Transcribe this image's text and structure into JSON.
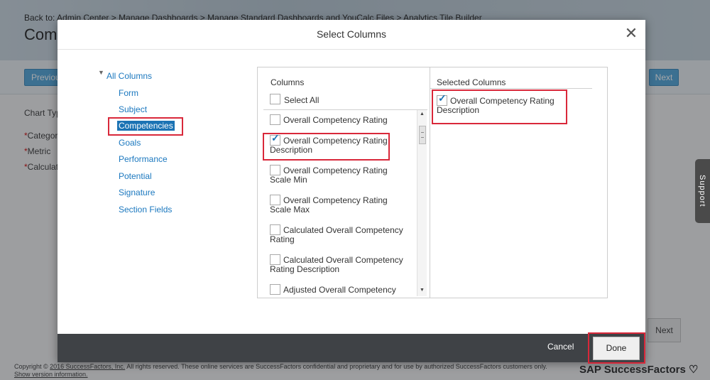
{
  "background": {
    "breadcrumb": "Back to: Admin Center > Manage Dashboards > Manage Standard Dashboards and YouCalc Files > Analytics Tile Builder",
    "page_title": "Comp",
    "previous_label": "Previous",
    "next_top_label": "Next",
    "next_bottom_label": "Next",
    "fields": [
      {
        "required": "",
        "label": "Chart Typ"
      },
      {
        "required": "*",
        "label": "Categor"
      },
      {
        "required": "*",
        "label": "Metric"
      },
      {
        "required": "*",
        "label": "Calculati"
      }
    ],
    "footer": {
      "copyright_prefix": "Copyright © ",
      "copyright_link": "2016 SuccessFactors, Inc.",
      "copyright_rest": " All rights reserved. These online services are SuccessFactors confidential and proprietary and for use by authorized SuccessFactors customers only.",
      "version_link": "Show version information."
    },
    "logo_text": "SAP SuccessFactors",
    "support_tab": "Support"
  },
  "modal": {
    "title": "Select Columns",
    "close_glyph": "✕",
    "tree": {
      "root_label": "All Columns",
      "items": [
        "Form",
        "Subject",
        "Competencies",
        "Goals",
        "Performance",
        "Potential",
        "Signature",
        "Section Fields"
      ],
      "selected": "Competencies"
    },
    "columns": {
      "header": "Columns",
      "select_all_label": "Select All",
      "items": [
        {
          "label": "Overall Competency Rating",
          "checked": false
        },
        {
          "label": "Overall Competency Rating Description",
          "checked": true
        },
        {
          "label": "Overall Competency Rating Scale Min",
          "checked": false
        },
        {
          "label": "Overall Competency Rating Scale Max",
          "checked": false
        },
        {
          "label": "Calculated Overall Competency Rating",
          "checked": false
        },
        {
          "label": "Calculated Overall Competency Rating Description",
          "checked": false
        },
        {
          "label": "Adjusted Overall Competency",
          "checked": false
        }
      ]
    },
    "selected_columns": {
      "header": "Selected Columns",
      "items": [
        {
          "label": "Overall Competency Rating Description",
          "checked": true
        }
      ]
    },
    "footer": {
      "cancel_label": "Cancel",
      "done_label": "Done"
    }
  },
  "colors": {
    "link_blue": "#1b78bf",
    "selection_blue": "#1b73b4",
    "highlight_red": "#d9283a",
    "footer_dark": "#3f4246"
  }
}
